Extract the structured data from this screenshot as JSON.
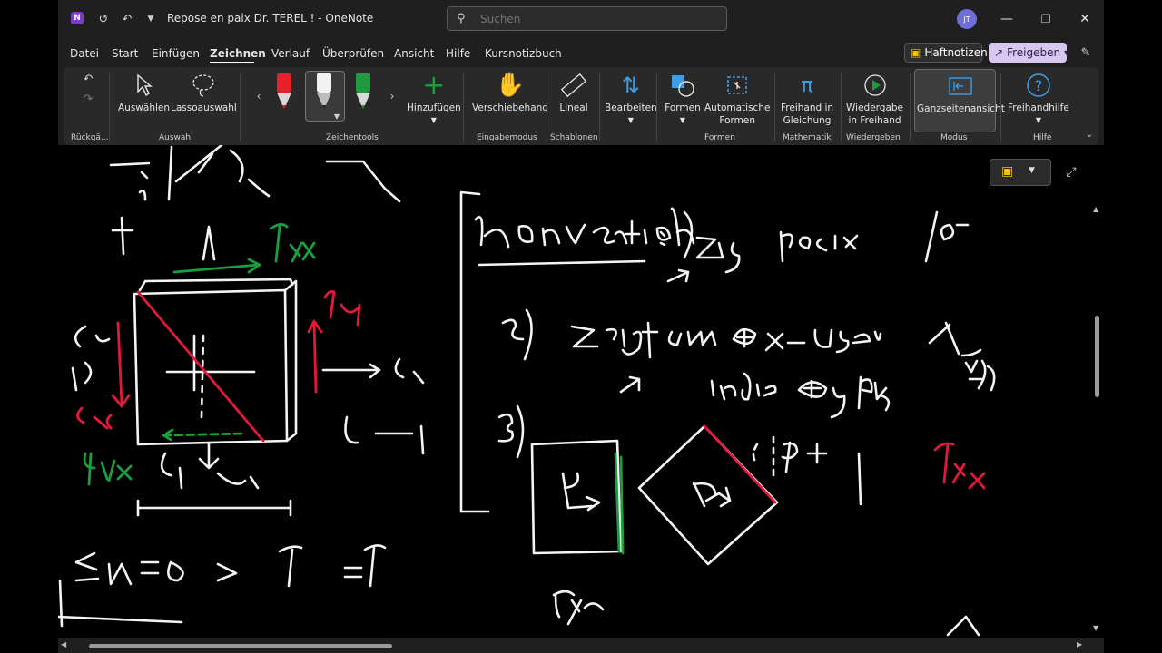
{
  "window": {
    "title": "Repose en paix Dr. TEREL !  -  OneNote",
    "app_icon": "N",
    "avatar_initials": "JT"
  },
  "search": {
    "placeholder": "Suchen"
  },
  "menu": {
    "items": [
      "Datei",
      "Start",
      "Einfügen",
      "Zeichnen",
      "Verlauf",
      "Überprüfen",
      "Ansicht",
      "Hilfe",
      "Kursnotizbuch"
    ],
    "active": "Zeichnen",
    "sticky_notes": "Haftnotizen",
    "share": "Freigeben"
  },
  "ribbon": {
    "groups": {
      "undo": "Rückgä...",
      "selection": "Auswahl",
      "drawing_tools": "Zeichentools",
      "input_mode": "Eingabemodus",
      "stencils": "Schablonen",
      "shapes": "Formen",
      "math": "Mathematik",
      "playback": "Wiedergeben",
      "mode": "Modus",
      "help": "Hilfe"
    },
    "buttons": {
      "select": "Auswählen",
      "lasso": "Lassoauswahl",
      "add": "Hinzufügen",
      "pan": "Verschiebehand",
      "ruler": "Lineal",
      "edit": "Bearbeiten",
      "shapes": "Formen",
      "auto_shapes_1": "Automatische",
      "auto_shapes_2": "Formen",
      "ink_eq_1": "Freihand in",
      "ink_eq_2": "Gleichung",
      "replay_1": "Wiedergabe",
      "replay_2": "in Freihand",
      "fullpage": "Ganzseitenansicht",
      "ink_help": "Freihandhilfe"
    },
    "pen_colors": {
      "red": "#e8202a",
      "white": "#f2f2f2",
      "green": "#1f9a3c"
    }
  },
  "colors": {
    "ink_white": "#f4f4f4",
    "ink_red": "#e3193a",
    "ink_green": "#1a9e3e",
    "accent_blue": "#3d9ee8"
  }
}
